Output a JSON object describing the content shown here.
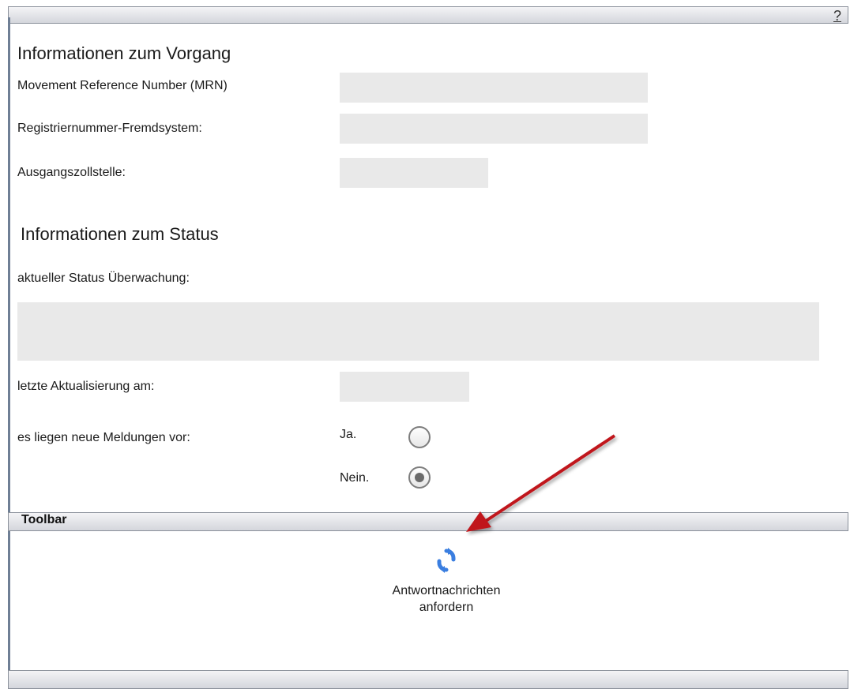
{
  "help_label": "?",
  "vorgang": {
    "heading": "Informationen zum Vorgang",
    "mrn_label": "Movement Reference Number (MRN)",
    "mrn_value": "",
    "regnr_label": "Registriernummer-Fremdsystem:",
    "regnr_value": "",
    "ausgang_label": "Ausgangszollstelle:",
    "ausgang_value": ""
  },
  "status": {
    "heading": "Informationen zum Status",
    "current_label": "aktueller Status Überwachung:",
    "current_value": "",
    "updated_label": "letzte Aktualisierung am:",
    "updated_value": "",
    "new_messages_label": "es liegen neue Meldungen vor:",
    "options": [
      {
        "label": "Ja.",
        "selected": false
      },
      {
        "label": "Nein.",
        "selected": true
      }
    ]
  },
  "toolbar": {
    "title": "Toolbar",
    "action_line1": "Antwortnachrichten",
    "action_line2": "anfordern",
    "icon": "refresh-link-icon",
    "icon_color": "#3a7ee0"
  },
  "annotation_arrow_color": "#c0191c"
}
